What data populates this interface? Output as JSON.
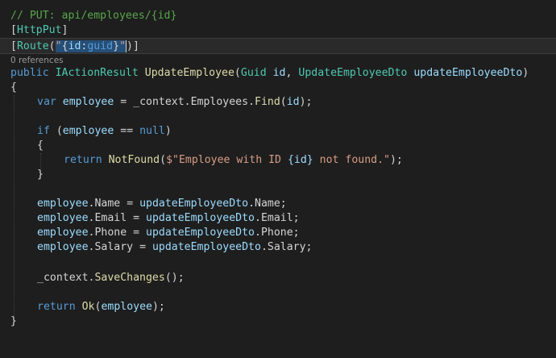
{
  "editor": {
    "codelens": "0 references",
    "lines": {
      "comment": "// PUT: api/employees/{id}",
      "attr_httpput": "HttpPut",
      "attr_route": "Route",
      "route_arg": "{id:guid}",
      "sig_public": "public",
      "sig_type": "IActionResult",
      "sig_name": "UpdateEmployee",
      "sig_ptype1": "Guid",
      "sig_pname1": "id",
      "sig_ptype2": "UpdateEmployeeDto",
      "sig_pname2": "updateEmployeeDto",
      "find_var": "var",
      "find_name": "employee",
      "find_rhs": "_context.Employees.",
      "find_method": "Find",
      "find_arg": "id",
      "if_kw": "if",
      "if_var": "employee",
      "if_null": "null",
      "ret_kw": "return",
      "ret_method": "NotFound",
      "ret_str_a": "$\"Employee with ID ",
      "ret_interp": "{id}",
      "ret_str_b": " not found.\"",
      "assign_name_lhs": "employee",
      "assign_name_prop": "Name",
      "assign_name_rhs": "updateEmployeeDto",
      "assign_email_lhs": "employee",
      "assign_email_prop": "Email",
      "assign_email_rhs": "updateEmployeeDto",
      "assign_phone_lhs": "employee",
      "assign_phone_prop": "Phone",
      "assign_phone_rhs": "updateEmployeeDto",
      "assign_salary_lhs": "employee",
      "assign_salary_prop": "Salary",
      "assign_salary_rhs": "updateEmployeeDto",
      "save_obj": "_context.",
      "save_method": "SaveChanges",
      "ok_kw": "return",
      "ok_method": "Ok",
      "ok_arg": "employee"
    }
  },
  "colors": {
    "background": "#1e1e1e",
    "keyword": "#569cd6",
    "type": "#4ec9b0",
    "method": "#dcdcaa",
    "string": "#d69d85",
    "comment": "#57a64a",
    "selection": "#264f78"
  }
}
